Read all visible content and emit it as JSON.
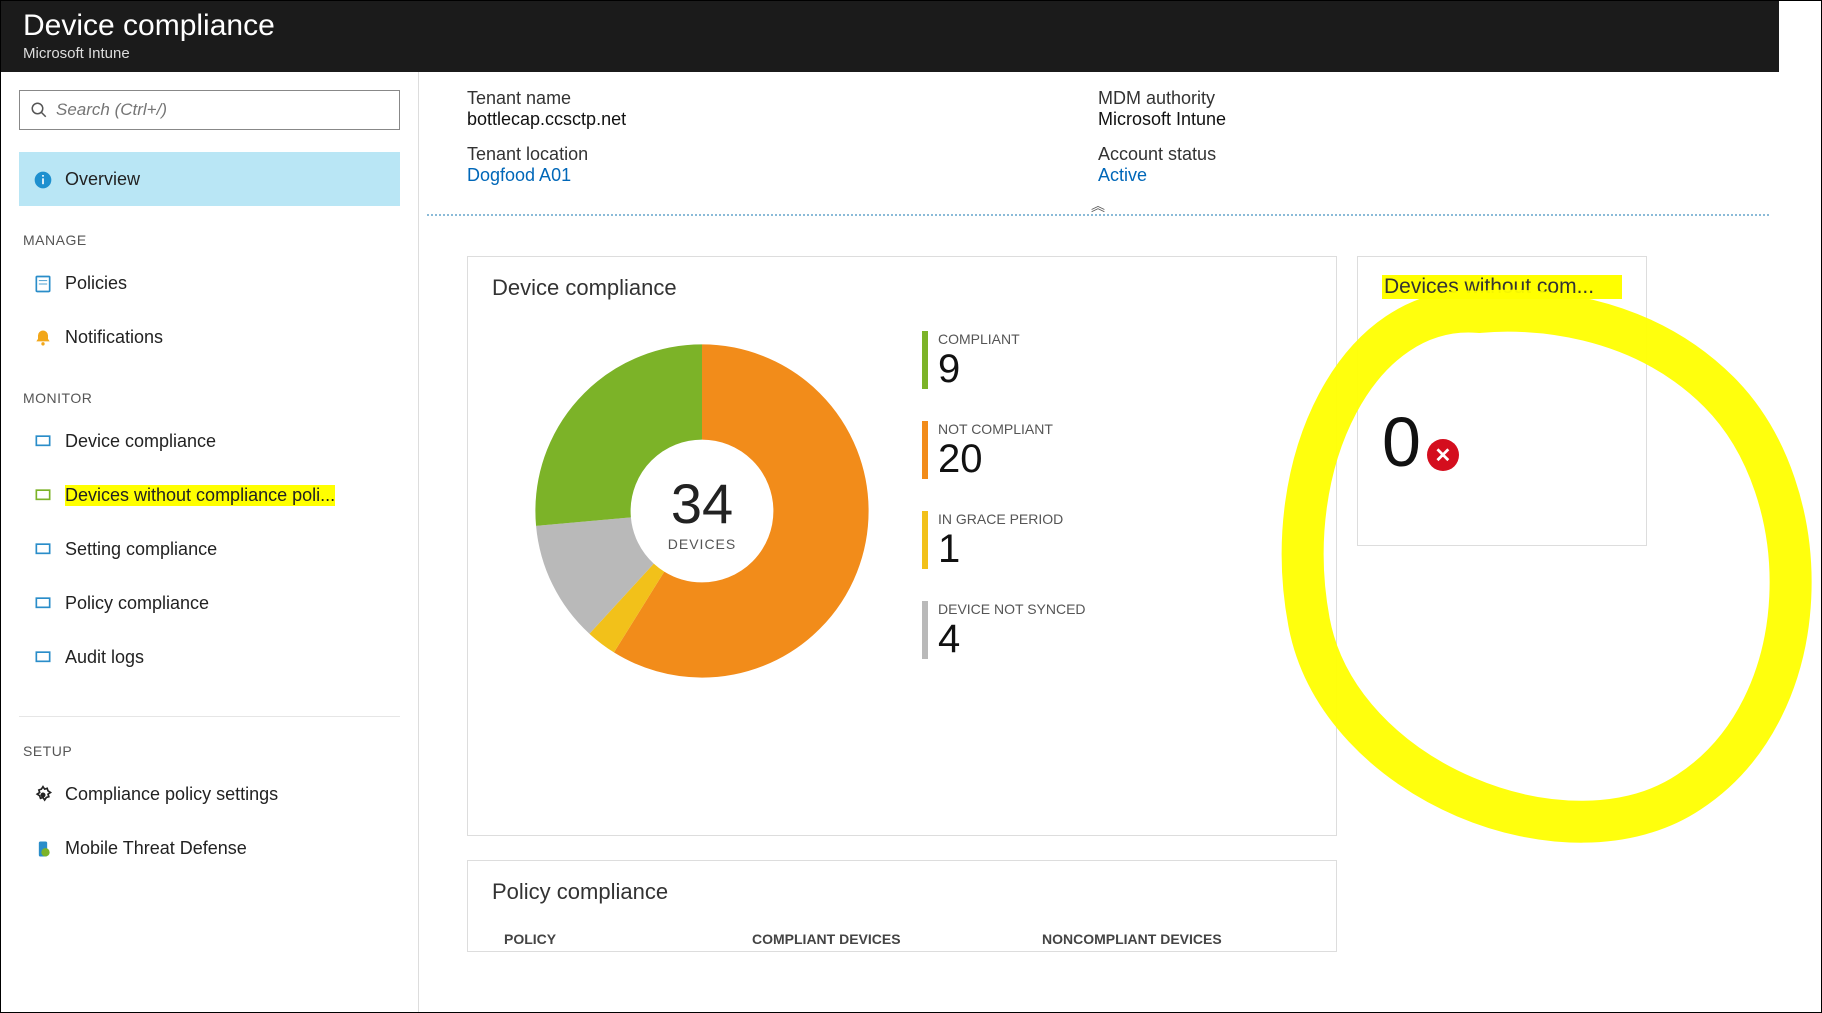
{
  "header": {
    "title": "Device compliance",
    "subtitle": "Microsoft Intune"
  },
  "search": {
    "placeholder": "Search (Ctrl+/)"
  },
  "nav": {
    "overview": "Overview",
    "sections": {
      "manage": "MANAGE",
      "monitor": "MONITOR",
      "setup": "SETUP"
    },
    "items": {
      "policies": "Policies",
      "notifications": "Notifications",
      "device_compliance": "Device compliance",
      "devices_without_policy": "Devices without compliance poli...",
      "setting_compliance": "Setting compliance",
      "policy_compliance": "Policy compliance",
      "audit_logs": "Audit logs",
      "compliance_policy_settings": "Compliance policy settings",
      "mobile_threat_defense": "Mobile Threat Defense"
    }
  },
  "tenant": {
    "name_label": "Tenant name",
    "name_value": "bottlecap.ccsctp.net",
    "location_label": "Tenant location",
    "location_value": "Dogfood A01",
    "mdm_label": "MDM authority",
    "mdm_value": "Microsoft Intune",
    "status_label": "Account status",
    "status_value": "Active"
  },
  "compliance_card": {
    "title": "Device compliance",
    "total_number": "34",
    "total_label": "DEVICES",
    "legend": {
      "compliant_label": "COMPLIANT",
      "compliant_value": "9",
      "not_compliant_label": "NOT COMPLIANT",
      "not_compliant_value": "20",
      "grace_label": "IN GRACE PERIOD",
      "grace_value": "1",
      "notsynced_label": "DEVICE NOT SYNCED",
      "notsynced_value": "4"
    }
  },
  "devices_without_card": {
    "title": "Devices without com...",
    "value": "0"
  },
  "policy_table": {
    "title": "Policy compliance",
    "columns": {
      "policy": "POLICY",
      "compliant": "COMPLIANT DEVICES",
      "noncompliant": "NONCOMPLIANT DEVICES"
    }
  },
  "colors": {
    "compliant": "#7cb328",
    "not_compliant": "#f28c1a",
    "grace": "#f2c11a",
    "not_synced": "#b9b9b9",
    "error": "#d40e1e"
  },
  "chart_data": {
    "type": "pie",
    "title": "Device compliance",
    "categories": [
      "COMPLIANT",
      "NOT COMPLIANT",
      "IN GRACE PERIOD",
      "DEVICE NOT SYNCED"
    ],
    "values": [
      9,
      20,
      1,
      4
    ],
    "total": 34,
    "colors": [
      "#7cb328",
      "#f28c1a",
      "#f2c11a",
      "#b9b9b9"
    ]
  }
}
